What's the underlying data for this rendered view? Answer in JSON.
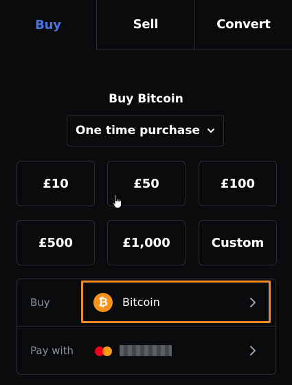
{
  "tabs": {
    "buy": "Buy",
    "sell": "Sell",
    "convert": "Convert"
  },
  "header": {
    "title": "Buy Bitcoin"
  },
  "purchase_type": {
    "selected": "One time purchase",
    "icon": "chevron-down-icon"
  },
  "amounts": [
    "£10",
    "£50",
    "£100",
    "£500",
    "£1,000",
    "Custom"
  ],
  "buy_row": {
    "label": "Buy",
    "asset": "Bitcoin",
    "asset_icon": "bitcoin-icon",
    "coin_symbol": "₿"
  },
  "pay_row": {
    "label": "Pay with",
    "card_icon": "mastercard-icon"
  },
  "colors": {
    "accent": "#4a73e8",
    "highlight": "#f08a24",
    "bitcoin": "#f7931a",
    "background": "#0a0b0d"
  }
}
